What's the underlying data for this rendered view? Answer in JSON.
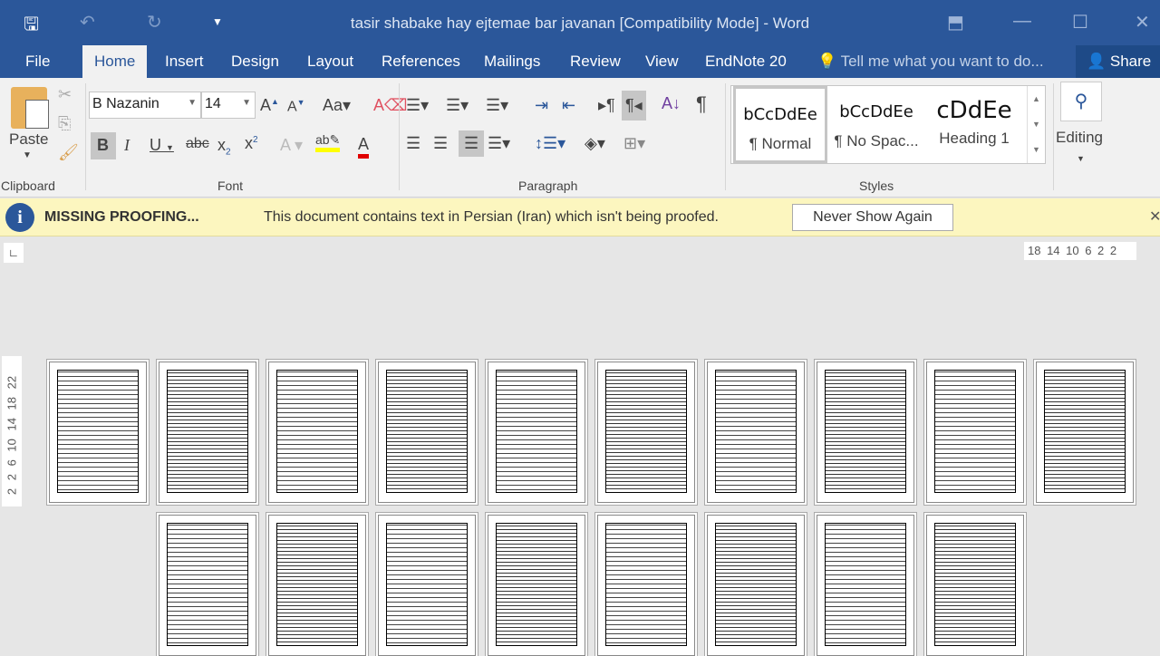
{
  "titlebar": {
    "title": "tasir shabake hay ejtemae  bar javanan [Compatibility Mode] - Word"
  },
  "tabs": [
    "File",
    "Home",
    "Insert",
    "Design",
    "Layout",
    "References",
    "Mailings",
    "Review",
    "View",
    "EndNote 20"
  ],
  "tell_me": "Tell me what you want to do...",
  "share": "Share",
  "clipboard": {
    "paste": "Paste",
    "label": "Clipboard"
  },
  "font": {
    "name": "B Nazanin",
    "size": "14",
    "label": "Font"
  },
  "paragraph": {
    "label": "Paragraph"
  },
  "styles": {
    "label": "Styles",
    "items": [
      {
        "sample": "bCcDdEe",
        "name": "¶ Normal"
      },
      {
        "sample": "bCcDdEe",
        "name": "¶ No Spac..."
      },
      {
        "sample": "cDdEe",
        "name": "Heading 1"
      }
    ]
  },
  "editing": "Editing",
  "message": {
    "title": "MISSING PROOFING...",
    "text": "This document contains text in Persian (Iran) which isn't being proofed.",
    "button": "Never Show Again"
  },
  "ruler": "18 14 10 6 2 2",
  "vruler": "2 2 6 10 14 18 22",
  "colors": {
    "brand": "#2b579a",
    "highlight": "#ffff00",
    "font_color": "#e00000"
  }
}
